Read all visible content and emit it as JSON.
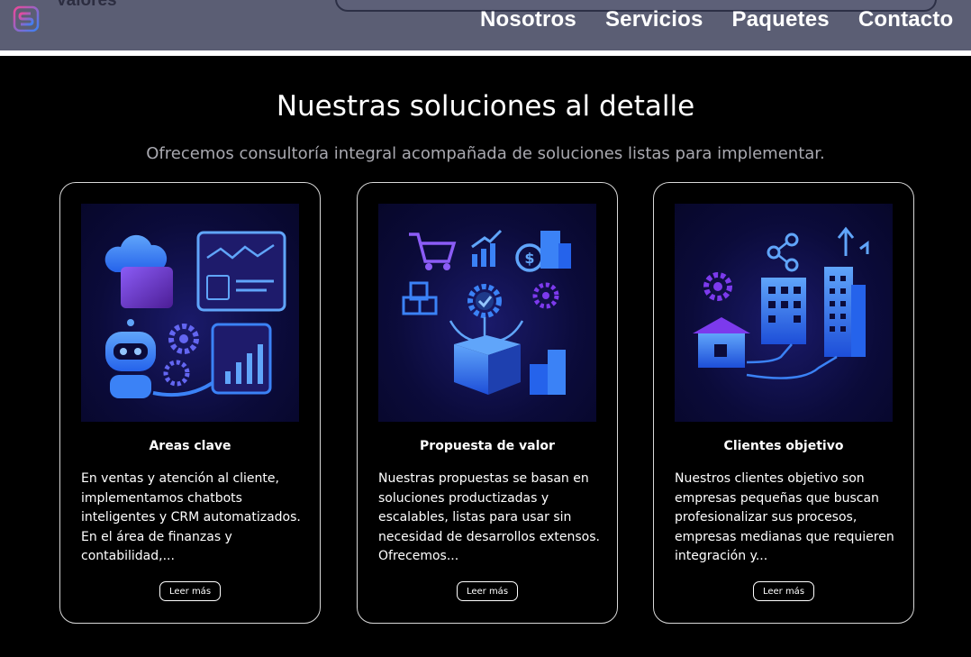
{
  "header": {
    "brand": "Valores",
    "nav": [
      "Nosotros",
      "Servicios",
      "Paquetes",
      "Contacto"
    ]
  },
  "section": {
    "title": "Nuestras soluciones al detalle",
    "subtitle": "Ofrecemos consultoría integral acompañada de soluciones listas para implementar."
  },
  "cards": [
    {
      "title": "Areas clave",
      "text": "En ventas y atención al cliente, implementamos chatbots inteligentes y CRM automatizados. En el área de finanzas y contabilidad,...",
      "button": "Leer más",
      "icon": "ai-automation-illustration"
    },
    {
      "title": "Propuesta de valor",
      "text": "Nuestras propuestas se basan en soluciones productizadas y escalables, listas para usar sin necesidad de desarrollos extensos. Ofrecemos...",
      "button": "Leer más",
      "icon": "product-box-illustration"
    },
    {
      "title": "Clientes objetivo",
      "text": "Nuestros clientes objetivo son empresas pequeñas que buscan profesionalizar sus procesos, empresas medianas que requieren integración y...",
      "button": "Leer más",
      "icon": "business-buildings-illustration"
    }
  ],
  "colors": {
    "header_bg": "#5b5e74",
    "page_bg": "#000000",
    "subtitle": "#a9a9b0",
    "illustration_bg": "#0b0b3a",
    "accent_blue": "#3b82f6",
    "accent_purple": "#7c3aed"
  }
}
